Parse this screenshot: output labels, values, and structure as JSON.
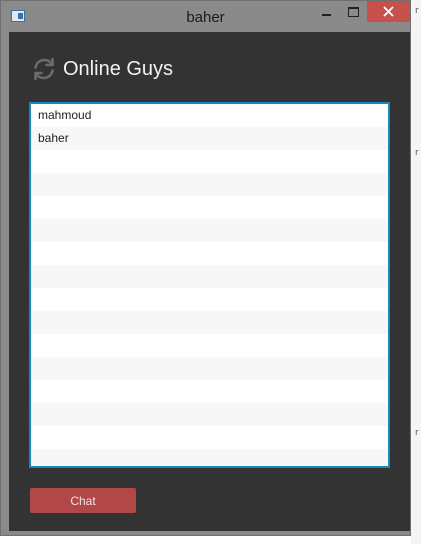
{
  "window": {
    "title": "baher"
  },
  "header": {
    "icon": "refresh-icon",
    "title": "Online Guys"
  },
  "online_users": [
    {
      "name": "mahmoud"
    },
    {
      "name": "baher"
    },
    {
      "name": ""
    },
    {
      "name": ""
    },
    {
      "name": ""
    },
    {
      "name": ""
    },
    {
      "name": ""
    },
    {
      "name": ""
    },
    {
      "name": ""
    },
    {
      "name": ""
    },
    {
      "name": ""
    },
    {
      "name": ""
    },
    {
      "name": ""
    },
    {
      "name": ""
    },
    {
      "name": ""
    },
    {
      "name": ""
    }
  ],
  "actions": {
    "chat_label": "Chat"
  },
  "colors": {
    "background": "#333333",
    "list_border": "#1789b8",
    "chat_button": "#b24747",
    "close_button": "#c7504c"
  }
}
